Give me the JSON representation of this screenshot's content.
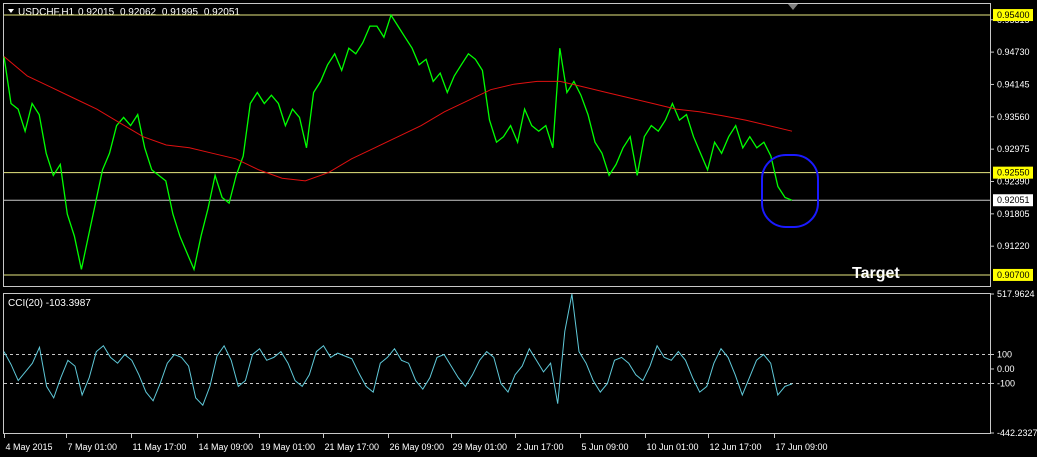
{
  "chart_data": [
    {
      "type": "line",
      "header": {
        "symbol": "USDCHF,H1",
        "open": "0.92015",
        "high": "0.92062",
        "low": "0.91995",
        "close": "0.92051"
      },
      "ylim": [
        0.905,
        0.956
      ],
      "yticks": [
        "0.95315",
        "0.94730",
        "0.94145",
        "0.93560",
        "0.92975",
        "0.92390",
        "0.91805",
        "0.91220"
      ],
      "xticks": [
        "4 May 2015",
        "7 May 01:00",
        "11 May 17:00",
        "14 May 09:00",
        "19 May 01:00",
        "21 May 17:00",
        "26 May 09:00",
        "29 May 01:00",
        "2 Jun 17:00",
        "5 Jun 09:00",
        "10 Jun 01:00",
        "12 Jun 17:00",
        "17 Jun 09:00"
      ],
      "levels": [
        {
          "value": 0.954,
          "label": "0.95400",
          "highlight": true
        },
        {
          "value": 0.9255,
          "label": "0.92550",
          "highlight": true
        },
        {
          "value": 0.92051,
          "label": "0.92051",
          "highlight": false
        },
        {
          "value": 0.907,
          "label": "0.90700",
          "highlight": true
        }
      ],
      "annotation": "Target",
      "series": [
        {
          "color": "#00ff00",
          "values": [
            0.9465,
            0.938,
            0.937,
            0.933,
            0.938,
            0.936,
            0.929,
            0.925,
            0.927,
            0.918,
            0.914,
            0.908,
            0.914,
            0.92,
            0.926,
            0.929,
            0.934,
            0.9355,
            0.934,
            0.936,
            0.93,
            0.926,
            0.925,
            0.924,
            0.918,
            0.914,
            0.911,
            0.908,
            0.914,
            0.919,
            0.925,
            0.921,
            0.92,
            0.925,
            0.9285,
            0.938,
            0.94,
            0.938,
            0.9395,
            0.938,
            0.934,
            0.937,
            0.9355,
            0.93,
            0.94,
            0.942,
            0.945,
            0.947,
            0.944,
            0.948,
            0.947,
            0.949,
            0.952,
            0.952,
            0.95,
            0.954,
            0.952,
            0.95,
            0.948,
            0.945,
            0.946,
            0.942,
            0.9435,
            0.94,
            0.943,
            0.945,
            0.947,
            0.946,
            0.944,
            0.935,
            0.931,
            0.932,
            0.934,
            0.931,
            0.937,
            0.934,
            0.933,
            0.934,
            0.93,
            0.948,
            0.94,
            0.942,
            0.9395,
            0.936,
            0.931,
            0.929,
            0.925,
            0.927,
            0.93,
            0.932,
            0.925,
            0.932,
            0.934,
            0.933,
            0.935,
            0.938,
            0.935,
            0.936,
            0.932,
            0.929,
            0.926,
            0.931,
            0.929,
            0.932,
            0.934,
            0.93,
            0.932,
            0.93,
            0.931,
            0.9285,
            0.923,
            0.921,
            0.92051
          ]
        },
        {
          "color": "#e01010",
          "values": [
            0.9465,
            0.943,
            0.941,
            0.939,
            0.937,
            0.9345,
            0.932,
            0.9305,
            0.93,
            0.929,
            0.928,
            0.926,
            0.9245,
            0.924,
            0.9255,
            0.928,
            0.93,
            0.932,
            0.934,
            0.9365,
            0.9385,
            0.9405,
            0.9415,
            0.942,
            0.942,
            0.941,
            0.94,
            0.939,
            0.938,
            0.937,
            0.9365,
            0.9358,
            0.935,
            0.934,
            0.933
          ]
        }
      ]
    },
    {
      "type": "line",
      "title": "CCI(20) -103.3987",
      "ylim": [
        -442.2327,
        517.9624
      ],
      "yticks": [
        "517.9624",
        "100",
        "0.00",
        "-100",
        "-442.2327"
      ],
      "levels": [
        100,
        -100
      ],
      "series": [
        {
          "color": "#5fc8d8",
          "values": [
            120,
            30,
            -80,
            -20,
            40,
            150,
            -120,
            -200,
            -60,
            60,
            20,
            -180,
            -60,
            120,
            160,
            80,
            40,
            100,
            60,
            -40,
            -160,
            -220,
            -100,
            40,
            100,
            80,
            20,
            -200,
            -250,
            -120,
            90,
            160,
            60,
            -120,
            -80,
            100,
            140,
            60,
            80,
            120,
            40,
            -80,
            -120,
            -40,
            120,
            160,
            80,
            110,
            90,
            70,
            -30,
            -120,
            -160,
            40,
            80,
            140,
            60,
            40,
            -80,
            -140,
            -60,
            80,
            100,
            20,
            -60,
            -120,
            -40,
            60,
            120,
            80,
            -100,
            -160,
            -40,
            20,
            140,
            60,
            -20,
            40,
            -240,
            260,
            517,
            120,
            40,
            -80,
            -160,
            -100,
            60,
            80,
            40,
            -40,
            -80,
            20,
            160,
            80,
            60,
            120,
            60,
            -60,
            -160,
            -120,
            40,
            140,
            80,
            -40,
            -180,
            -60,
            60,
            100,
            40,
            -180,
            -120,
            -103.3987
          ]
        }
      ]
    }
  ]
}
